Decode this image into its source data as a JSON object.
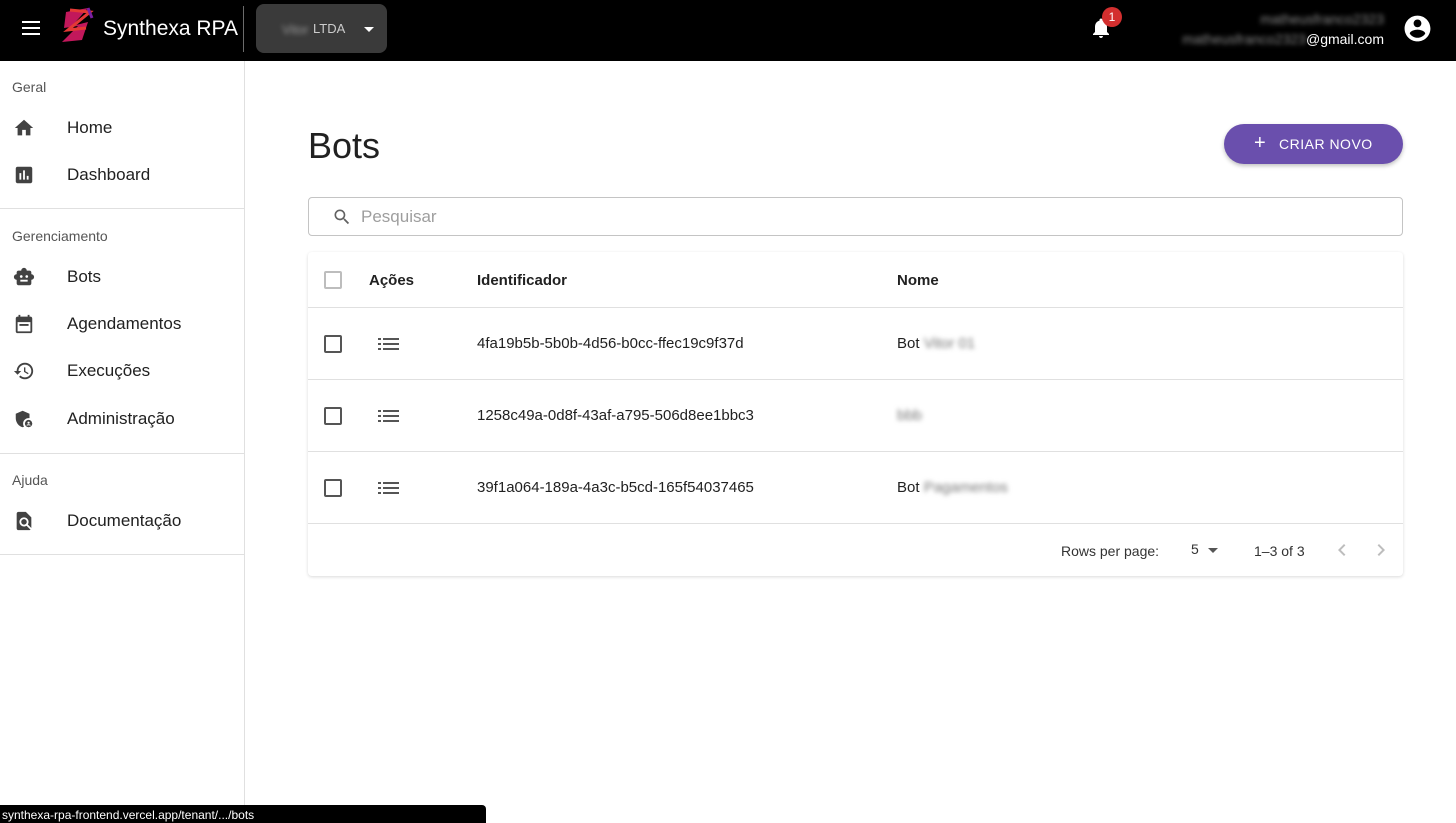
{
  "header": {
    "brand": "Synthexa RPA",
    "tenant_blur": "Vitor",
    "tenant_suffix": "LTDA",
    "notifications_count": "1",
    "user_name": "matheusfranco2323",
    "user_email_blur": "matheusfranco2323",
    "user_email_domain": "@gmail.com"
  },
  "sidebar": {
    "sections": [
      {
        "title": "Geral",
        "items": [
          {
            "label": "Home",
            "icon": "home-icon"
          },
          {
            "label": "Dashboard",
            "icon": "dashboard-icon"
          }
        ]
      },
      {
        "title": "Gerenciamento",
        "items": [
          {
            "label": "Bots",
            "icon": "bot-icon"
          },
          {
            "label": "Agendamentos",
            "icon": "calendar-icon"
          },
          {
            "label": "Execuções",
            "icon": "history-icon"
          },
          {
            "label": "Administração",
            "icon": "admin-shield-icon"
          }
        ]
      },
      {
        "title": "Ajuda",
        "items": [
          {
            "label": "Documentação",
            "icon": "docs-search-icon"
          }
        ]
      }
    ]
  },
  "main": {
    "title": "Bots",
    "create_label": "CRIAR NOVO",
    "search_placeholder": "Pesquisar",
    "table": {
      "columns": [
        "Ações",
        "Identificador",
        "Nome"
      ],
      "rows": [
        {
          "id": "4fa19b5b-5b0b-4d56-b0cc-ffec19c9f37d",
          "name_prefix": "Bot",
          "name_blur": "Vitor 01"
        },
        {
          "id": "1258c49a-0d8f-43af-a795-506d8ee1bbc3",
          "name_prefix": "",
          "name_blur": "bbb"
        },
        {
          "id": "39f1a064-189a-4a3c-b5cd-165f54037465",
          "name_prefix": "Bot",
          "name_blur": "Pagamentos"
        }
      ]
    },
    "pagination": {
      "rows_per_page_label": "Rows per page:",
      "rows_per_page": "5",
      "range": "1–3 of 3"
    }
  },
  "status_bar": {
    "url": "synthexa-rpa-frontend.vercel.app/tenant/.../bots"
  },
  "colors": {
    "accent": "#6a4fad",
    "badge": "#d32f2f",
    "topbar": "#000000"
  }
}
